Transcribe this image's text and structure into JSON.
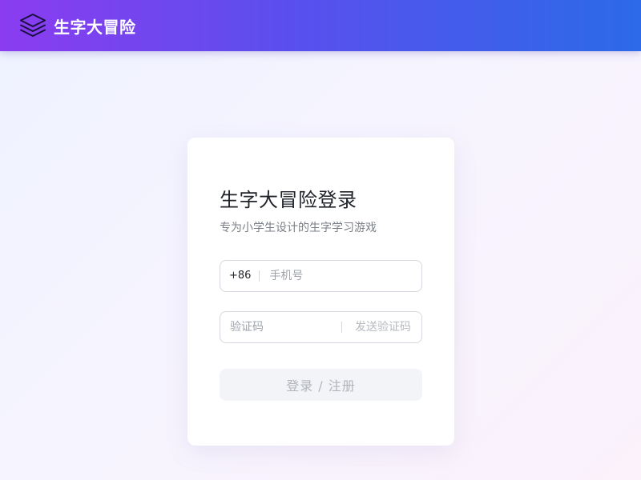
{
  "header": {
    "brand": "生字大冒险",
    "logo_icon": "layers-icon",
    "gradient": [
      "#8b3cf0",
      "#5a4fee",
      "#2b6ae8"
    ]
  },
  "login": {
    "title": "生字大冒险登录",
    "subtitle": "专为小学生设计的生字学习游戏",
    "phone": {
      "prefix": "+86",
      "placeholder": "手机号",
      "value": ""
    },
    "code": {
      "placeholder": "验证码",
      "value": "",
      "send_label": "发送验证码"
    },
    "submit_label": "登录 / 注册"
  }
}
